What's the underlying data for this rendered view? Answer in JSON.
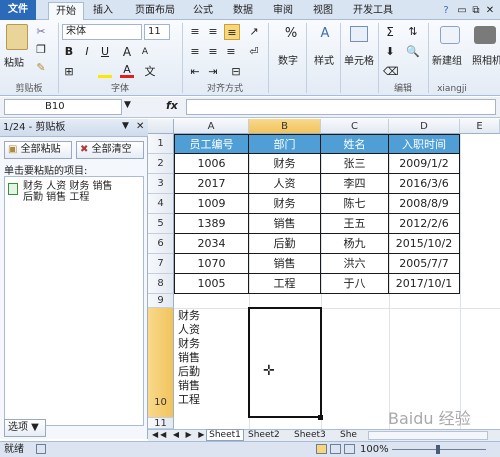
{
  "tabs": [
    "文件",
    "开始",
    "插入",
    "页面布局",
    "公式",
    "数据",
    "审阅",
    "视图",
    "开发工具"
  ],
  "ribbon": {
    "paste_label": "粘贴",
    "font_name": "宋体",
    "font_size": "11",
    "bold": "B",
    "italic": "I",
    "underline": "U",
    "grow_font": "A",
    "shrink_font": "A",
    "number_label": "数字",
    "style_label": "样式",
    "cells_label": "单元格",
    "new_group_label": "新建组",
    "percent_symbol": "%",
    "sigma_symbol": "Σ",
    "groups": {
      "clipboard": "剪贴板",
      "font": "字体",
      "alignment": "对齐方式",
      "editing": "编辑",
      "user": "xiangji"
    },
    "right_label": "照相机"
  },
  "formula_bar": {
    "name_box": "B10",
    "fx": "fx",
    "formula": ""
  },
  "clipboard_pane": {
    "title": "1/24 - 剪贴板",
    "paste_all": "全部粘贴",
    "clear_all": "全部清空",
    "hint": "单击要粘贴的项目:",
    "item_line1": "财务 人资 财务 销售",
    "item_line2": "后勤 销售 工程",
    "options": "选项 ▼"
  },
  "sheet": {
    "columns": [
      "A",
      "B",
      "C",
      "D",
      "E"
    ],
    "rows": [
      "1",
      "2",
      "3",
      "4",
      "5",
      "6",
      "7",
      "8",
      "9",
      "10",
      "11"
    ],
    "headers": [
      "员工编号",
      "部门",
      "姓名",
      "入职时间"
    ],
    "data": [
      [
        "1006",
        "财务",
        "张三",
        "2009/1/2"
      ],
      [
        "2017",
        "人资",
        "李四",
        "2016/3/6"
      ],
      [
        "1009",
        "财务",
        "陈七",
        "2008/8/9"
      ],
      [
        "1389",
        "销售",
        "王五",
        "2012/2/6"
      ],
      [
        "2034",
        "后勤",
        "杨九",
        "2015/10/2"
      ],
      [
        "1070",
        "销售",
        "洪六",
        "2005/7/7"
      ],
      [
        "1005",
        "工程",
        "于八",
        "2017/10/1"
      ]
    ],
    "a9_lines": [
      "财务",
      "人资",
      "财务",
      "销售",
      "后勤",
      "销售",
      "工程"
    ]
  },
  "sheet_tabs": [
    "Sheet1",
    "Sheet2",
    "Sheet3",
    "She"
  ],
  "status": {
    "mode": "就绪",
    "zoom": "100%",
    "watermark": "Baidu 经验"
  },
  "colors": {
    "header_fill": "#4f9fd6",
    "file_tab": "#2a6ab8"
  }
}
